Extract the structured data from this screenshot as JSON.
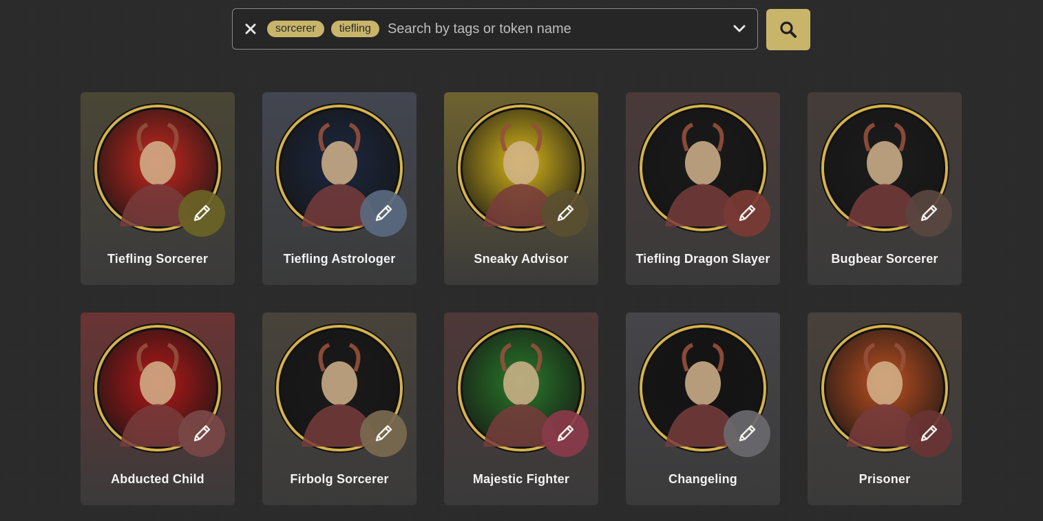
{
  "search": {
    "tags": [
      "sorcerer",
      "tiefling"
    ],
    "placeholder": "Search by tags or token name",
    "value": ""
  },
  "icons": {
    "clear": "close-icon",
    "dropdown": "chevron-down-icon",
    "search": "search-icon",
    "edit": "pencil-icon"
  },
  "colors": {
    "background": "#2a2a2a",
    "accent": "#c8b56a",
    "token_ring": "#d6b34a"
  },
  "tokens": [
    {
      "name": "Tiefling Sorcerer",
      "card_color": "#4a4636",
      "portrait_bg": "#c9271e",
      "edit_color": "#6b6326"
    },
    {
      "name": "Tiefling Astrologer",
      "card_color": "#424650",
      "portrait_bg": "#1c2840",
      "edit_color": "#5b6a80"
    },
    {
      "name": "Sneaky Advisor",
      "card_color": "#6e6230",
      "portrait_bg": "#d9b81a",
      "edit_color": "#5a5030"
    },
    {
      "name": "Tiefling Dragon Slayer",
      "card_color": "#4a3a3a",
      "portrait_bg": "#1a1a1a",
      "edit_color": "#7a3a34"
    },
    {
      "name": "Bugbear Sorcerer",
      "card_color": "#443c38",
      "portrait_bg": "#1c1c1c",
      "edit_color": "#5a4640"
    },
    {
      "name": "Abducted Child",
      "card_color": "#6a3434",
      "portrait_bg": "#b81818",
      "edit_color": "#7a4848"
    },
    {
      "name": "Firbolg Sorcerer",
      "card_color": "#48423a",
      "portrait_bg": "#1a1a1a",
      "edit_color": "#7a6a50"
    },
    {
      "name": "Majestic Fighter",
      "card_color": "#4e3838",
      "portrait_bg": "#2a7a2a",
      "edit_color": "#8a3a4a"
    },
    {
      "name": "Changeling",
      "card_color": "#45454a",
      "portrait_bg": "#141414",
      "edit_color": "#6a6a6e"
    },
    {
      "name": "Prisoner",
      "card_color": "#48403a",
      "portrait_bg": "#c05020",
      "edit_color": "#6a3434"
    }
  ]
}
